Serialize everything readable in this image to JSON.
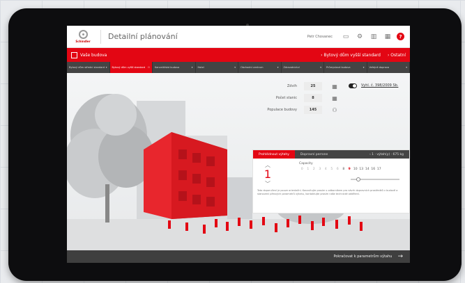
{
  "header": {
    "logo_text": "Schindler",
    "app_title": "Detailní plánování",
    "user_name": "Petr Chovanec",
    "help_label": "?"
  },
  "redbar": {
    "title": "Vaše budova",
    "link_building": "› Bytový dům vyšší standard",
    "link_close": "› Ostatní"
  },
  "tabs": [
    {
      "label": "Bytový dům střední standard"
    },
    {
      "label": "Bytový dům vyšší standard",
      "active": true
    },
    {
      "label": "Kancelářská budova"
    },
    {
      "label": "Hotel"
    },
    {
      "label": "Obchodní centrum"
    },
    {
      "label": "Zdravotnictví"
    },
    {
      "label": "Průmyslová budova"
    },
    {
      "label": "Veřejné doprava"
    }
  ],
  "fields": {
    "floors_label": "Zdvih",
    "floors_value": "25",
    "stops_label": "Počet stanic",
    "stops_value": "8",
    "population_label": "Populace budovy",
    "population_value": "145",
    "norm_link": "Vyhl. č. 398/2009 Sb."
  },
  "card": {
    "tab_active": "Prohlédnout výtahy",
    "tab_other": "Dopravní perrone",
    "tab_right": "‹ 1 · výtah(y) · 675 kg",
    "floor_value": "1",
    "capacity_label": "Capacity",
    "scale": [
      "0",
      "1",
      "2",
      "3",
      "4",
      "5",
      "6",
      "8",
      "9",
      "10",
      "13",
      "14",
      "16",
      "17"
    ],
    "note": "Tato doporučení je pouze orientační. Konzultujte prosím s odborníkem pro návrh dopravních prostředků v budově a stanovení přesných parametrů výtahu, kontaktujte prosím naše technické oddělení."
  },
  "footer": {
    "cta_label": "Pokračovat k parametrům výtahu",
    "arrow": "→"
  }
}
